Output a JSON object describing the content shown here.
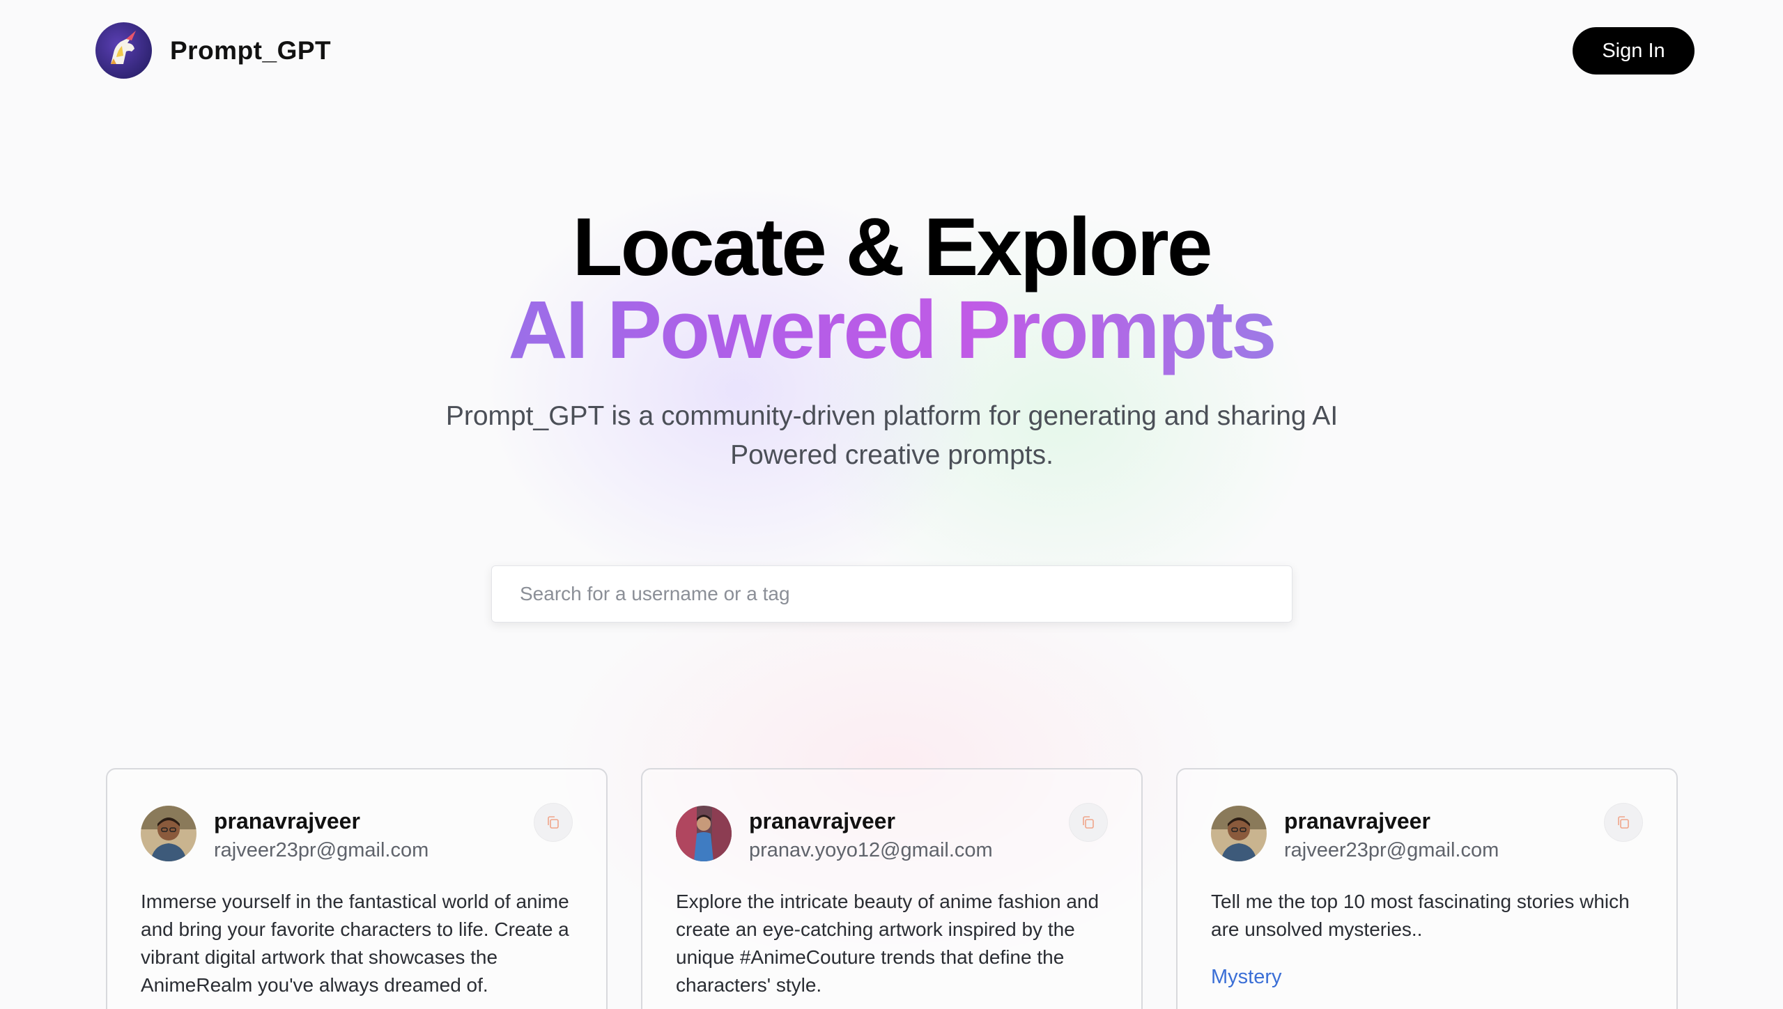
{
  "header": {
    "brand": "Prompt_GPT",
    "signin_label": "Sign In"
  },
  "hero": {
    "title_line1": "Locate & Explore",
    "title_line2": "AI Powered Prompts",
    "subtitle": "Prompt_GPT is a community-driven platform for generating and sharing AI Powered creative prompts."
  },
  "search": {
    "placeholder": "Search for a username or a tag",
    "value": ""
  },
  "cards": [
    {
      "username": "pranavrajveer",
      "email": "rajveer23pr@gmail.com",
      "prompt": "Immerse yourself in the fantastical world of anime and bring your favorite characters to life. Create a vibrant digital artwork that showcases the AnimeRealm you've always dreamed of.",
      "tag": ""
    },
    {
      "username": "pranavrajveer",
      "email": "pranav.yoyo12@gmail.com",
      "prompt": "Explore the intricate beauty of anime fashion and create an eye-catching artwork inspired by the unique #AnimeCouture trends that define the characters' style.",
      "tag": ""
    },
    {
      "username": "pranavrajveer",
      "email": "rajveer23pr@gmail.com",
      "prompt": "Tell me the top 10 most fascinating stories which are unsolved mysteries..",
      "tag": "Mystery"
    }
  ],
  "colors": {
    "accent_gradient_start": "#9b6fe8",
    "accent_gradient_end": "#c05be6",
    "tag_link": "#3b6fd6",
    "signin_bg": "#000000"
  },
  "icons": {
    "logo": "unicorn-logo-icon",
    "copy": "copy-icon"
  }
}
